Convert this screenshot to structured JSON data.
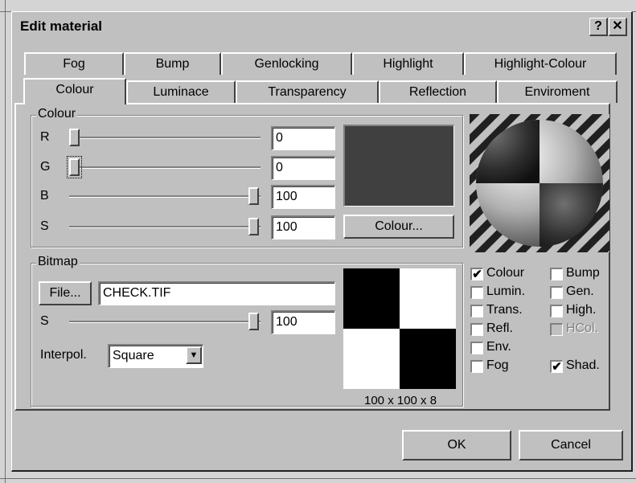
{
  "dialog": {
    "title": "Edit material",
    "help_label": "?",
    "close_label": "✕"
  },
  "tabs_back": [
    "Fog",
    "Bump",
    "Genlocking",
    "Highlight",
    "Highlight-Colour"
  ],
  "tabs_front": [
    "Colour",
    "Luminace",
    "Transparency",
    "Reflection",
    "Enviroment"
  ],
  "active_tab": "Colour",
  "colour_group": {
    "label": "Colour",
    "r_label": "R",
    "r_value": "0",
    "g_label": "G",
    "g_value": "0",
    "b_label": "B",
    "b_value": "100",
    "s_label": "S",
    "s_value": "100",
    "colour_button": "Colour...",
    "swatch_color": "#404040"
  },
  "bitmap_group": {
    "label": "Bitmap",
    "file_button": "File...",
    "file_value": "CHECK.TIF",
    "s_label": "S",
    "s_value": "100",
    "interpol_label": "Interpol.",
    "interpol_value": "Square",
    "bitmap_info": "100 x 100 x 8"
  },
  "options": {
    "colour": {
      "label": "Colour",
      "checked": true
    },
    "bump": {
      "label": "Bump",
      "checked": false
    },
    "lumin": {
      "label": "Lumin.",
      "checked": false
    },
    "gen": {
      "label": "Gen.",
      "checked": false
    },
    "trans": {
      "label": "Trans.",
      "checked": false
    },
    "high": {
      "label": "High.",
      "checked": false
    },
    "refl": {
      "label": "Refl.",
      "checked": false
    },
    "hcol": {
      "label": "HCol.",
      "checked": false,
      "disabled": true
    },
    "env": {
      "label": "Env.",
      "checked": false
    },
    "fog": {
      "label": "Fog",
      "checked": false
    },
    "shad": {
      "label": "Shad.",
      "checked": true
    }
  },
  "buttons": {
    "ok": "OK",
    "cancel": "Cancel"
  }
}
